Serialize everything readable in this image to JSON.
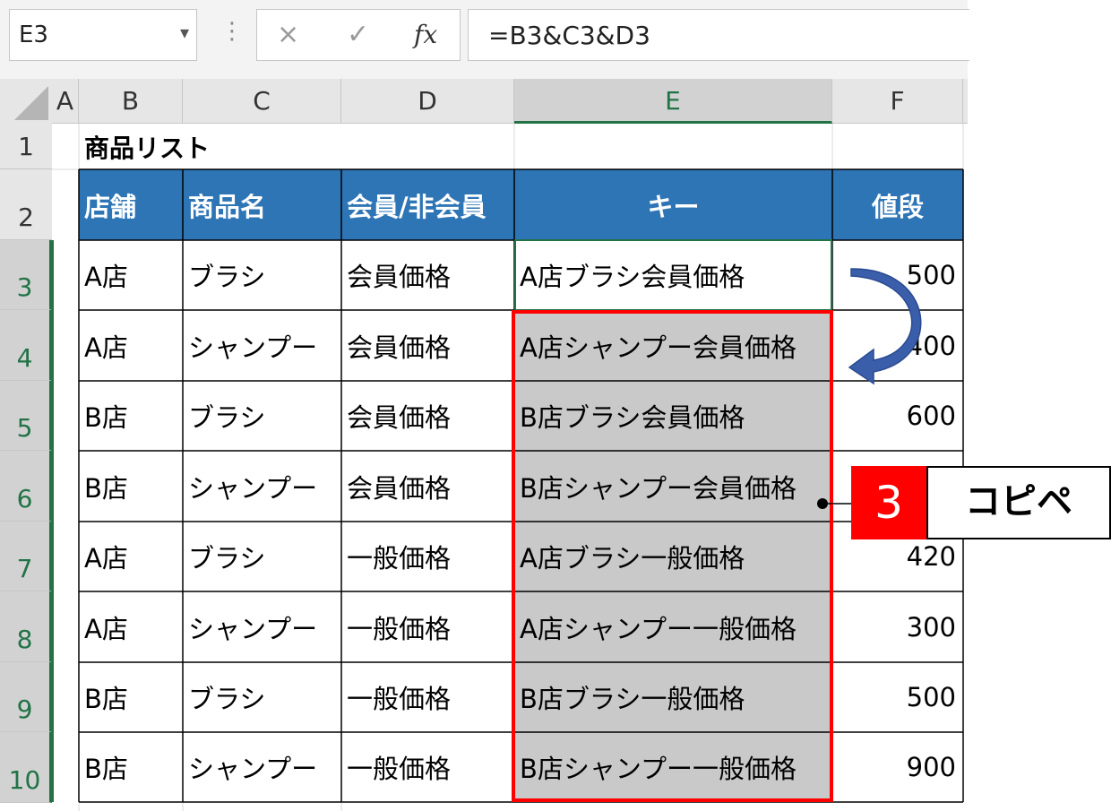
{
  "formula_bar": {
    "name_box": "E3",
    "cancel_icon": "×",
    "enter_icon": "✓",
    "fx_label": "fx",
    "formula": "=B3&C3&D3"
  },
  "columns": [
    "A",
    "B",
    "C",
    "D",
    "E",
    "F"
  ],
  "rows": [
    "1",
    "2",
    "3",
    "4",
    "5",
    "6",
    "7",
    "8",
    "9",
    "10"
  ],
  "sheet": {
    "title": "商品リスト",
    "headers": [
      "店舗",
      "商品名",
      "会員/非会員",
      "キー",
      "値段"
    ],
    "data": [
      [
        "A店",
        "ブラシ",
        "会員価格",
        "A店ブラシ会員価格",
        "500"
      ],
      [
        "A店",
        "シャンプー",
        "会員価格",
        "A店シャンプー会員価格",
        "400"
      ],
      [
        "B店",
        "ブラシ",
        "会員価格",
        "B店ブラシ会員価格",
        "600"
      ],
      [
        "B店",
        "シャンプー",
        "会員価格",
        "B店シャンプー会員価格",
        ""
      ],
      [
        "A店",
        "ブラシ",
        "一般価格",
        "A店ブラシ一般価格",
        "420"
      ],
      [
        "A店",
        "シャンプー",
        "一般価格",
        "A店シャンプー一般価格",
        "300"
      ],
      [
        "B店",
        "ブラシ",
        "一般価格",
        "B店ブラシ一般価格",
        "500"
      ],
      [
        "B店",
        "シャンプー",
        "一般価格",
        "B店シャンプー一般価格",
        "900"
      ]
    ]
  },
  "annotation": {
    "step_number": "3",
    "step_label": "コピペ"
  },
  "colors": {
    "header_fill": "#2e75b6",
    "selection_fill": "#c9c9c9",
    "highlight_border": "#ff0000",
    "active_green": "#217346",
    "arrow": "#3b5eab"
  }
}
